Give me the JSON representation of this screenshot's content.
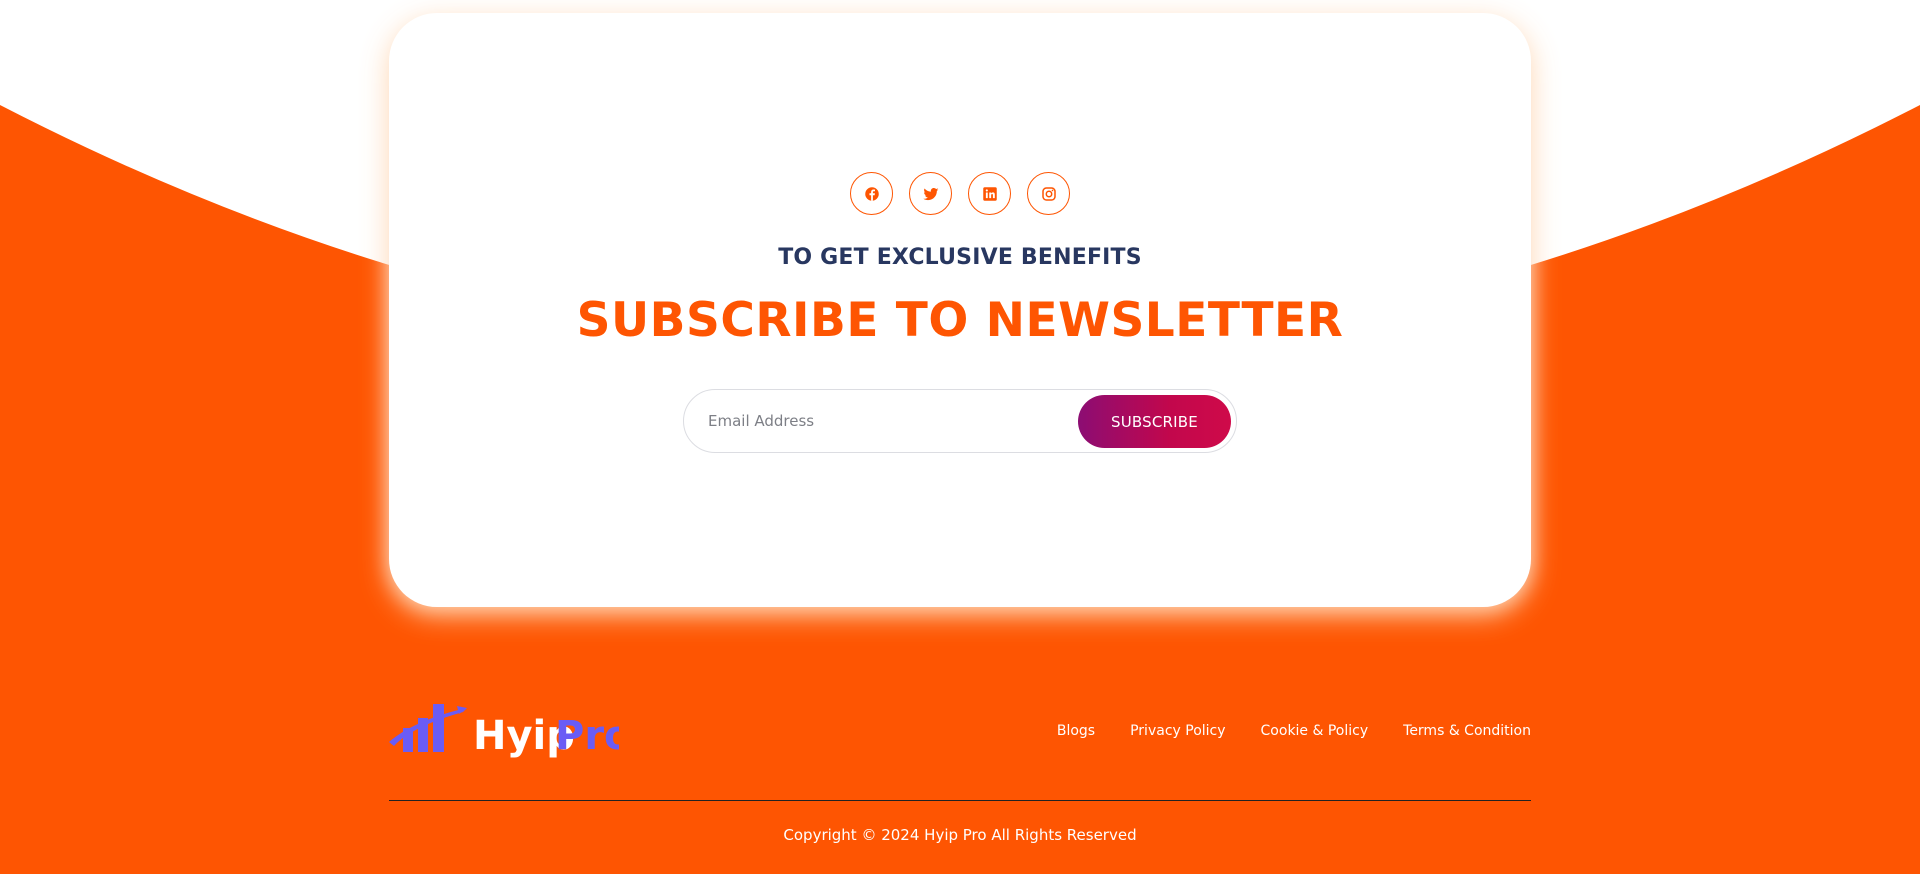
{
  "colors": {
    "brand_orange": "#fe5502",
    "navy": "#283760",
    "button_gradient_start": "#8c0d73",
    "button_gradient_end": "#cf0a4a",
    "logo_purple": "#6a5cf5",
    "white": "#ffffff"
  },
  "newsletter": {
    "social": [
      {
        "name": "facebook",
        "icon": "facebook-icon"
      },
      {
        "name": "twitter",
        "icon": "twitter-icon"
      },
      {
        "name": "linkedin",
        "icon": "linkedin-icon"
      },
      {
        "name": "instagram",
        "icon": "instagram-icon"
      }
    ],
    "eyebrow": "TO GET EXCLUSIVE BENEFITS",
    "headline": "SUBSCRIBE TO NEWSLETTER",
    "email_placeholder": "Email Address",
    "email_value": "",
    "subscribe_label": "SUBSCRIBE"
  },
  "footer": {
    "logo": {
      "word1": "Hyip",
      "word2": "Pro",
      "icon": "bar-chart-logo-icon"
    },
    "links": [
      {
        "label": "Blogs"
      },
      {
        "label": "Privacy Policy"
      },
      {
        "label": "Cookie & Policy"
      },
      {
        "label": "Terms & Condition"
      }
    ],
    "copyright": "Copyright © 2024 Hyip Pro All Rights Reserved"
  }
}
